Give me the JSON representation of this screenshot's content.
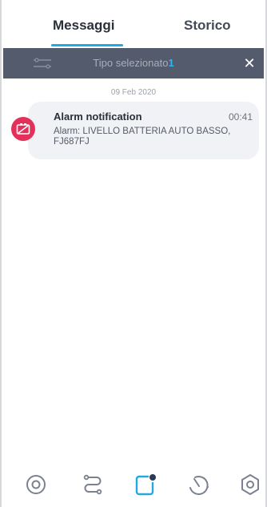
{
  "tabs": {
    "messages": "Messaggi",
    "history": "Storico"
  },
  "filter": {
    "label": "Tipo selezionato",
    "count": "1",
    "close": "✕"
  },
  "date_separator": "09 Feb 2020",
  "notification": {
    "title": "Alarm notification",
    "time": "00:41",
    "body": "Alarm: LIVELLO BATTERIA AUTO BASSO, FJ687FJ",
    "icon": "battery-low-icon"
  },
  "bottom_nav": {
    "items": [
      "target-icon",
      "route-icon",
      "messages-icon",
      "speedometer-icon",
      "settings-hex-icon"
    ],
    "active": "messages-icon"
  },
  "colors": {
    "accent": "#23a8e0",
    "filter_bar": "#545b6c",
    "alarm": "#e3315a",
    "card_bg": "#f1f2f5"
  }
}
